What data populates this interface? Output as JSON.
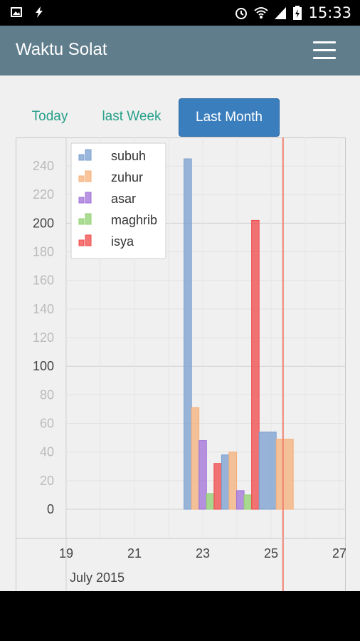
{
  "status_bar": {
    "time": "15:33",
    "left_icons": [
      "image-icon",
      "lightning-icon"
    ],
    "right_icons": [
      "alarm-icon",
      "wifi-icon",
      "signal-icon",
      "battery-charging-icon"
    ]
  },
  "app_bar": {
    "title": "Waktu Solat",
    "menu_icon": "hamburger-menu-icon"
  },
  "tabs": [
    {
      "label": "Today",
      "active": false
    },
    {
      "label": "last Week",
      "active": false
    },
    {
      "label": "Last Month",
      "active": true
    }
  ],
  "colors": {
    "app_bar": "#607d8b",
    "tab_text": "#26a08a",
    "tab_active_bg": "#3a7ebe",
    "marker_line": "#f08070"
  },
  "chart_data": {
    "type": "bar",
    "x_axis": {
      "tick_labels": [
        "19",
        "21",
        "23",
        "25",
        "27"
      ],
      "sublabel": "July 2015"
    },
    "y_axis": {
      "ticks": [
        0,
        20,
        40,
        60,
        80,
        100,
        120,
        140,
        160,
        180,
        200,
        220,
        240
      ],
      "ylim": [
        -20,
        260
      ]
    },
    "legend": {
      "placement": "top-left"
    },
    "grid": true,
    "series": [
      {
        "name": "subuh",
        "color": "#7a9fcf"
      },
      {
        "name": "zuhur",
        "color": "#f5b07a"
      },
      {
        "name": "asar",
        "color": "#a070d8"
      },
      {
        "name": "maghrib",
        "color": "#90d070"
      },
      {
        "name": "isya",
        "color": "#f04848"
      }
    ],
    "bars": [
      {
        "series": "subuh",
        "x": 22.45,
        "width": 0.22,
        "value": 245
      },
      {
        "series": "zuhur",
        "x": 22.67,
        "width": 0.22,
        "value": 71
      },
      {
        "series": "asar",
        "x": 22.89,
        "width": 0.22,
        "value": 48
      },
      {
        "series": "maghrib",
        "x": 23.11,
        "width": 0.22,
        "value": 11
      },
      {
        "series": "isya",
        "x": 23.33,
        "width": 0.22,
        "value": 32
      },
      {
        "series": "subuh",
        "x": 23.55,
        "width": 0.22,
        "value": 38
      },
      {
        "series": "zuhur",
        "x": 23.77,
        "width": 0.22,
        "value": 40
      },
      {
        "series": "asar",
        "x": 23.99,
        "width": 0.22,
        "value": 13
      },
      {
        "series": "maghrib",
        "x": 24.21,
        "width": 0.22,
        "value": 10
      },
      {
        "series": "isya",
        "x": 24.43,
        "width": 0.22,
        "value": 202
      },
      {
        "series": "subuh",
        "x": 24.65,
        "width": 0.5,
        "value": 54
      },
      {
        "series": "zuhur",
        "x": 25.15,
        "width": 0.5,
        "value": 49
      }
    ],
    "today_marker_x": 25.35
  }
}
